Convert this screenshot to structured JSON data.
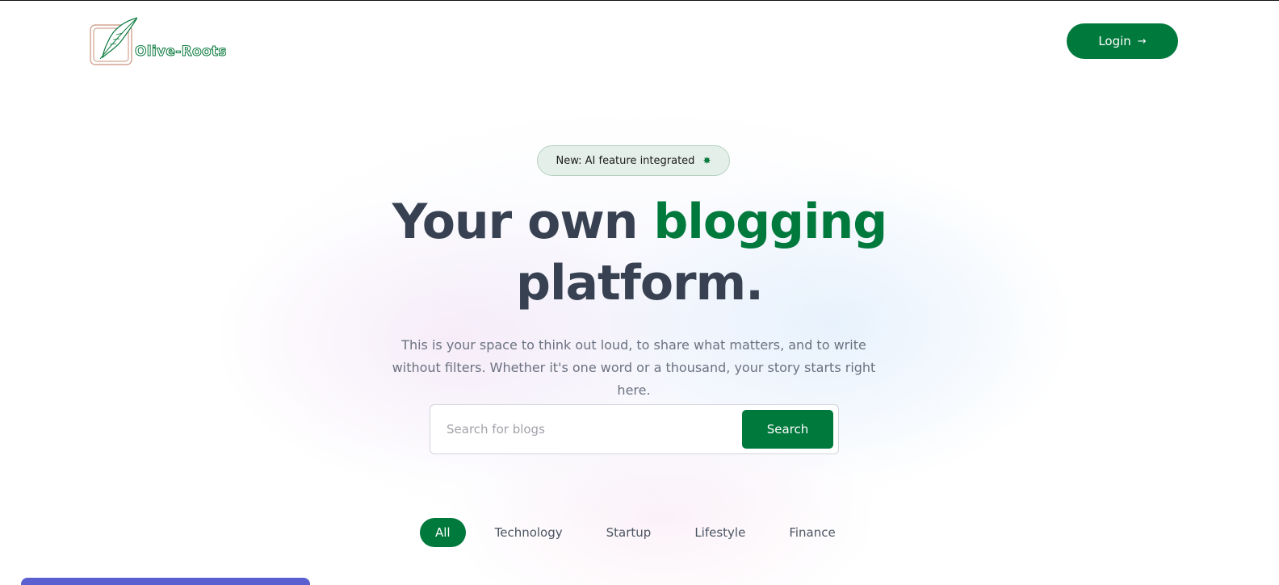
{
  "header": {
    "logo_text": "Olive-Roots",
    "logo_icon": "feather-icon",
    "login_label": "Login",
    "login_icon": "arrow-right-icon"
  },
  "badge": {
    "text": "New: AI feature integrated",
    "icon": "star-icon"
  },
  "hero": {
    "title_part1": "Your own",
    "title_accent": "blogging",
    "title_part2": "platform.",
    "subtitle": "This is your space to think out loud, to share what matters, and to write without filters. Whether it's one word or a thousand, your story starts right here."
  },
  "search": {
    "placeholder": "Search for blogs",
    "button_label": "Search"
  },
  "categories": [
    "All",
    "Technology",
    "Startup",
    "Lifestyle",
    "Finance"
  ],
  "active_category": "All",
  "colors": {
    "accent": "#00793d",
    "text_dark": "#374151",
    "text_muted": "#6b7280"
  }
}
